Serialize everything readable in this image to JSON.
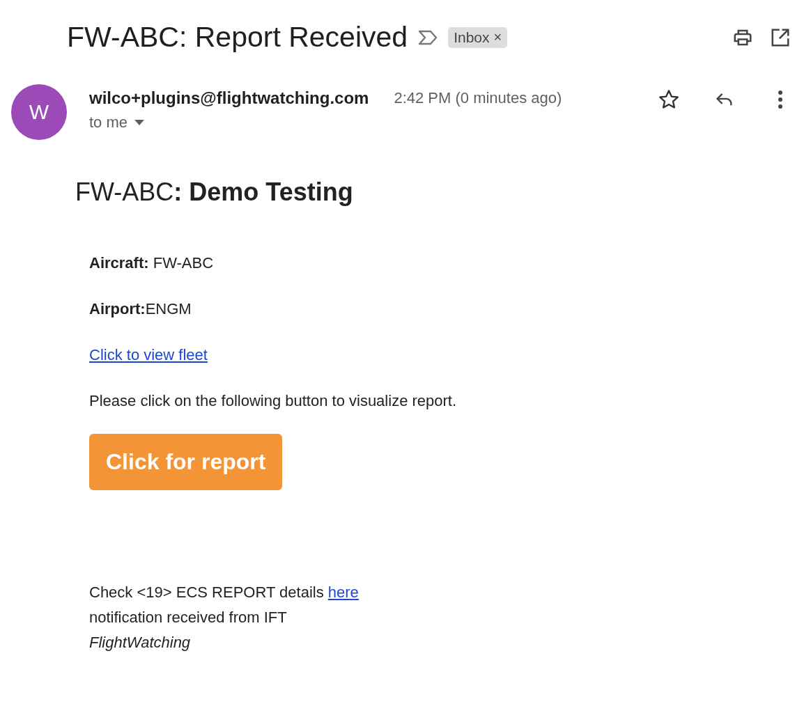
{
  "subject": "FW-ABC: Report Received",
  "label": {
    "text": "Inbox",
    "remove": "×"
  },
  "sender": {
    "avatar": "W",
    "email": "wilco+plugins@flightwatching.com",
    "time": "2:42 PM (0 minutes ago)",
    "recipient": "to me",
    "starred": false
  },
  "body": {
    "heading": "FW-ABC**: Demo Testing**",
    "fields": [
      {
        "text": "**Aircraft:** FW-ABC"
      },
      {
        "text": "**Airport:**ENGM"
      }
    ],
    "fleet_link": "Click to view fleet",
    "instruction": "Please click on the following button to visualize report.",
    "report_button": "Click for report",
    "footer": {
      "text": "Check <19> ECS REPORT details ",
      "link": "here",
      "notification": "notification received from IFT",
      "signature": "FlightWatching"
    }
  }
}
